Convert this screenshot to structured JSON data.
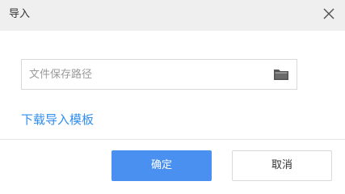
{
  "dialog": {
    "title": "导入",
    "close_icon": "close-icon"
  },
  "path_input": {
    "placeholder": "文件保存路径",
    "value": "",
    "folder_icon": "folder-icon"
  },
  "template_link": {
    "label": "下载导入模板"
  },
  "buttons": {
    "ok_label": "确定",
    "cancel_label": "取消"
  },
  "colors": {
    "header_bg": "#efefef",
    "link": "#2f8ef0",
    "primary": "#4a90f0",
    "border": "#d9d9d9"
  }
}
